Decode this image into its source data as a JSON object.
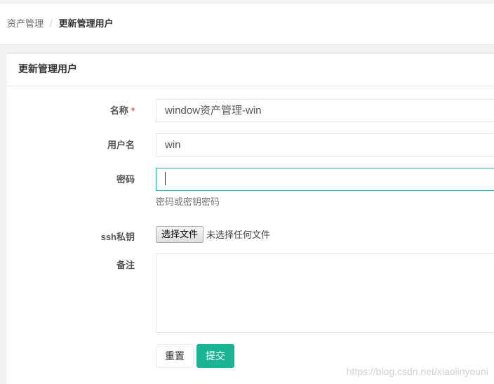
{
  "breadcrumb": {
    "parent": "资产管理",
    "separator": "/",
    "current": "更新管理用户"
  },
  "panel": {
    "title": "更新管理用户"
  },
  "form": {
    "name": {
      "label": "名称",
      "required_mark": "*",
      "value": "window资产管理-win"
    },
    "username": {
      "label": "用户名",
      "value": "win"
    },
    "password": {
      "label": "密码",
      "value": "",
      "help": "密码或密钥密码"
    },
    "ssh_key": {
      "label": "ssh私钥",
      "button": "选择文件",
      "status": "未选择任何文件"
    },
    "comment": {
      "label": "备注",
      "value": ""
    }
  },
  "actions": {
    "reset": "重置",
    "submit": "提交"
  },
  "watermark": "https://blog.csdn.net/xiaolinyouni",
  "colors": {
    "accent": "#1ab394",
    "required": "#ed5565"
  }
}
